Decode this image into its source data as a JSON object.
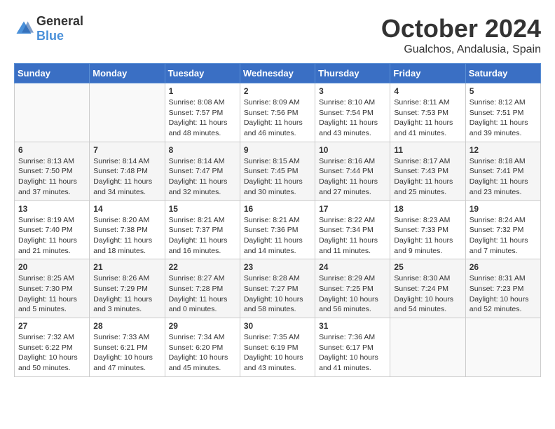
{
  "logo": {
    "general": "General",
    "blue": "Blue"
  },
  "header": {
    "month": "October 2024",
    "location": "Gualchos, Andalusia, Spain"
  },
  "weekdays": [
    "Sunday",
    "Monday",
    "Tuesday",
    "Wednesday",
    "Thursday",
    "Friday",
    "Saturday"
  ],
  "weeks": [
    [
      {
        "day": "",
        "info": ""
      },
      {
        "day": "",
        "info": ""
      },
      {
        "day": "1",
        "info": "Sunrise: 8:08 AM\nSunset: 7:57 PM\nDaylight: 11 hours and 48 minutes."
      },
      {
        "day": "2",
        "info": "Sunrise: 8:09 AM\nSunset: 7:56 PM\nDaylight: 11 hours and 46 minutes."
      },
      {
        "day": "3",
        "info": "Sunrise: 8:10 AM\nSunset: 7:54 PM\nDaylight: 11 hours and 43 minutes."
      },
      {
        "day": "4",
        "info": "Sunrise: 8:11 AM\nSunset: 7:53 PM\nDaylight: 11 hours and 41 minutes."
      },
      {
        "day": "5",
        "info": "Sunrise: 8:12 AM\nSunset: 7:51 PM\nDaylight: 11 hours and 39 minutes."
      }
    ],
    [
      {
        "day": "6",
        "info": "Sunrise: 8:13 AM\nSunset: 7:50 PM\nDaylight: 11 hours and 37 minutes."
      },
      {
        "day": "7",
        "info": "Sunrise: 8:14 AM\nSunset: 7:48 PM\nDaylight: 11 hours and 34 minutes."
      },
      {
        "day": "8",
        "info": "Sunrise: 8:14 AM\nSunset: 7:47 PM\nDaylight: 11 hours and 32 minutes."
      },
      {
        "day": "9",
        "info": "Sunrise: 8:15 AM\nSunset: 7:45 PM\nDaylight: 11 hours and 30 minutes."
      },
      {
        "day": "10",
        "info": "Sunrise: 8:16 AM\nSunset: 7:44 PM\nDaylight: 11 hours and 27 minutes."
      },
      {
        "day": "11",
        "info": "Sunrise: 8:17 AM\nSunset: 7:43 PM\nDaylight: 11 hours and 25 minutes."
      },
      {
        "day": "12",
        "info": "Sunrise: 8:18 AM\nSunset: 7:41 PM\nDaylight: 11 hours and 23 minutes."
      }
    ],
    [
      {
        "day": "13",
        "info": "Sunrise: 8:19 AM\nSunset: 7:40 PM\nDaylight: 11 hours and 21 minutes."
      },
      {
        "day": "14",
        "info": "Sunrise: 8:20 AM\nSunset: 7:38 PM\nDaylight: 11 hours and 18 minutes."
      },
      {
        "day": "15",
        "info": "Sunrise: 8:21 AM\nSunset: 7:37 PM\nDaylight: 11 hours and 16 minutes."
      },
      {
        "day": "16",
        "info": "Sunrise: 8:21 AM\nSunset: 7:36 PM\nDaylight: 11 hours and 14 minutes."
      },
      {
        "day": "17",
        "info": "Sunrise: 8:22 AM\nSunset: 7:34 PM\nDaylight: 11 hours and 11 minutes."
      },
      {
        "day": "18",
        "info": "Sunrise: 8:23 AM\nSunset: 7:33 PM\nDaylight: 11 hours and 9 minutes."
      },
      {
        "day": "19",
        "info": "Sunrise: 8:24 AM\nSunset: 7:32 PM\nDaylight: 11 hours and 7 minutes."
      }
    ],
    [
      {
        "day": "20",
        "info": "Sunrise: 8:25 AM\nSunset: 7:30 PM\nDaylight: 11 hours and 5 minutes."
      },
      {
        "day": "21",
        "info": "Sunrise: 8:26 AM\nSunset: 7:29 PM\nDaylight: 11 hours and 3 minutes."
      },
      {
        "day": "22",
        "info": "Sunrise: 8:27 AM\nSunset: 7:28 PM\nDaylight: 11 hours and 0 minutes."
      },
      {
        "day": "23",
        "info": "Sunrise: 8:28 AM\nSunset: 7:27 PM\nDaylight: 10 hours and 58 minutes."
      },
      {
        "day": "24",
        "info": "Sunrise: 8:29 AM\nSunset: 7:25 PM\nDaylight: 10 hours and 56 minutes."
      },
      {
        "day": "25",
        "info": "Sunrise: 8:30 AM\nSunset: 7:24 PM\nDaylight: 10 hours and 54 minutes."
      },
      {
        "day": "26",
        "info": "Sunrise: 8:31 AM\nSunset: 7:23 PM\nDaylight: 10 hours and 52 minutes."
      }
    ],
    [
      {
        "day": "27",
        "info": "Sunrise: 7:32 AM\nSunset: 6:22 PM\nDaylight: 10 hours and 50 minutes."
      },
      {
        "day": "28",
        "info": "Sunrise: 7:33 AM\nSunset: 6:21 PM\nDaylight: 10 hours and 47 minutes."
      },
      {
        "day": "29",
        "info": "Sunrise: 7:34 AM\nSunset: 6:20 PM\nDaylight: 10 hours and 45 minutes."
      },
      {
        "day": "30",
        "info": "Sunrise: 7:35 AM\nSunset: 6:19 PM\nDaylight: 10 hours and 43 minutes."
      },
      {
        "day": "31",
        "info": "Sunrise: 7:36 AM\nSunset: 6:17 PM\nDaylight: 10 hours and 41 minutes."
      },
      {
        "day": "",
        "info": ""
      },
      {
        "day": "",
        "info": ""
      }
    ]
  ]
}
